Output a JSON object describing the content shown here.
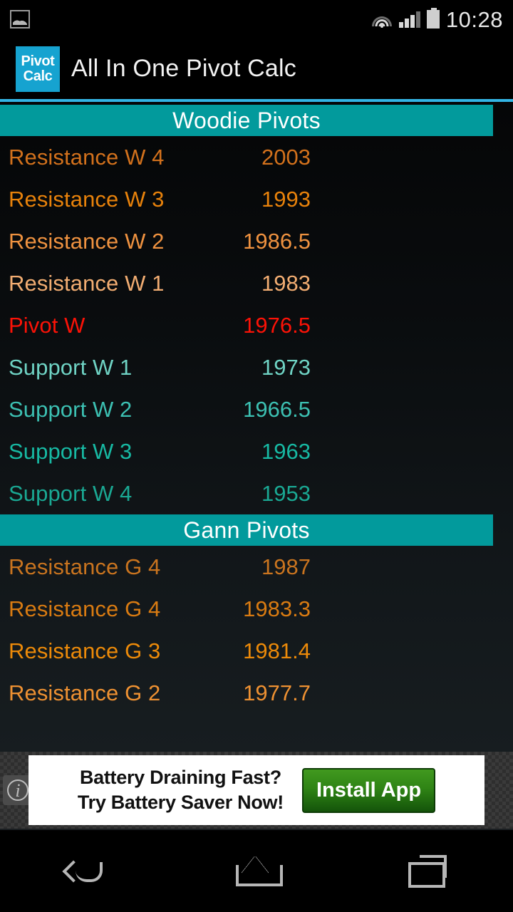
{
  "status_bar": {
    "notification_icon": "photo-icon",
    "wifi_icon": "wifi-icon",
    "signal_icon": "signal-icon",
    "battery_icon": "battery-icon",
    "time": "10:28"
  },
  "action_bar": {
    "logo_line1": "Pivot",
    "logo_line2": "Calc",
    "title": "All In One Pivot Calc",
    "logo_color": "#16a3d0",
    "accent_rule_color": "#33b5e5"
  },
  "theme": {
    "section_header_bg": "#029a9c",
    "pivot_color": "#fb1207",
    "resistance_colors": [
      "#d2711c",
      "#e8820b",
      "#ef9240",
      "#f2ad72"
    ],
    "support_colors": [
      "#6fd3c4",
      "#3cc0b2",
      "#17b9a3",
      "#1aa893"
    ]
  },
  "sections": [
    {
      "title": "Woodie Pivots",
      "rows": [
        {
          "label": "Resistance W 4",
          "value": "2003",
          "color": "#d2711c"
        },
        {
          "label": "Resistance W 3",
          "value": "1993",
          "color": "#e8820b"
        },
        {
          "label": "Resistance W 2",
          "value": "1986.5",
          "color": "#ef9240"
        },
        {
          "label": "Resistance W 1",
          "value": "1983",
          "color": "#f2ad72"
        },
        {
          "label": "Pivot W",
          "value": "1976.5",
          "color": "#fb1207"
        },
        {
          "label": "Support W 1",
          "value": "1973",
          "color": "#6fd3c4"
        },
        {
          "label": "Support W 2",
          "value": "1966.5",
          "color": "#3cc0b2"
        },
        {
          "label": "Support W 3",
          "value": "1963",
          "color": "#17b9a3"
        },
        {
          "label": "Support W 4",
          "value": "1953",
          "color": "#1aa893"
        }
      ]
    },
    {
      "title": "Gann Pivots",
      "rows": [
        {
          "label": "Resistance G 4",
          "value": "1987",
          "color": "#c9741f"
        },
        {
          "label": "Resistance G 4",
          "value": "1983.3",
          "color": "#d97b12"
        },
        {
          "label": "Resistance G 3",
          "value": "1981.4",
          "color": "#ec8a09"
        },
        {
          "label": "Resistance G 2",
          "value": "1977.7",
          "color": "#ee9132"
        }
      ]
    }
  ],
  "ad": {
    "info_glyph": "i",
    "line1": "Battery Draining Fast?",
    "line2": "Try Battery Saver Now!",
    "button_label": "Install App"
  },
  "nav_bar": {
    "back": "back-button",
    "home": "home-button",
    "recents": "recents-button"
  }
}
